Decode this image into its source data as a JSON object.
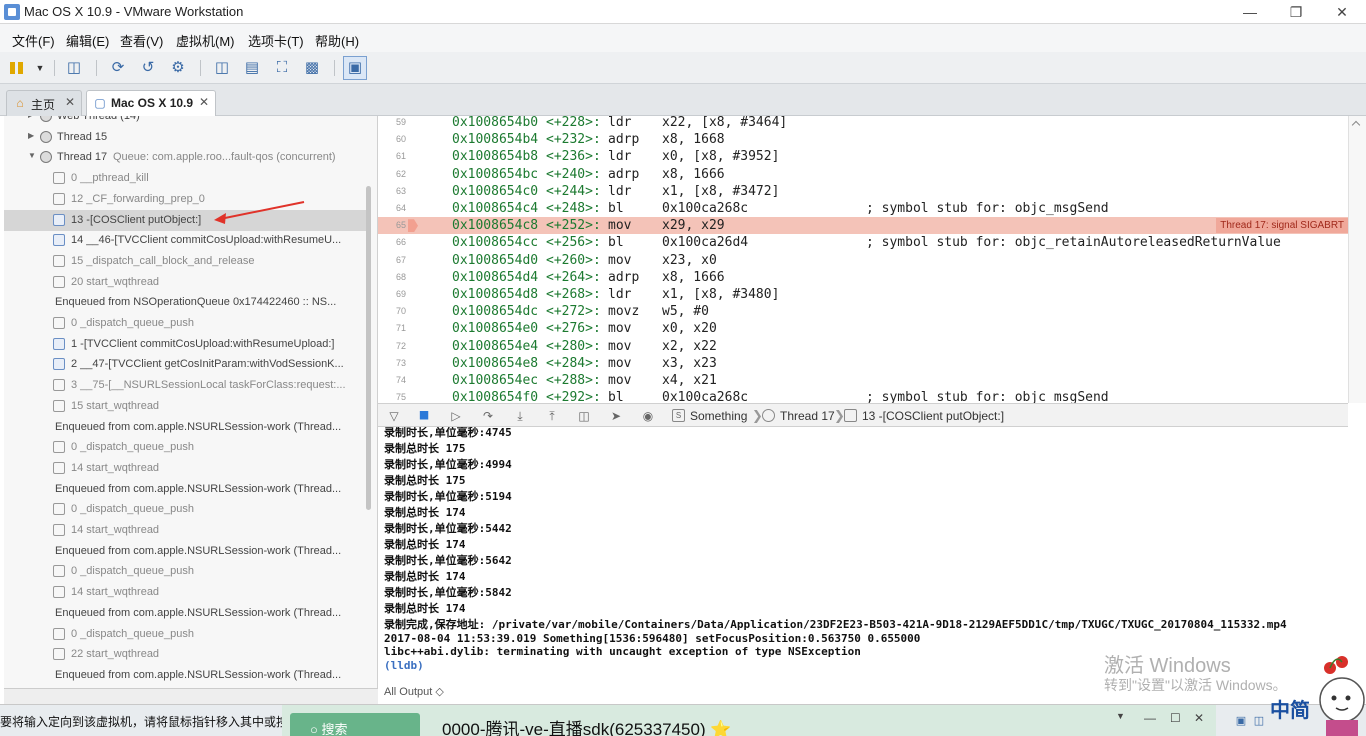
{
  "window": {
    "title": "Mac OS X 10.9 - VMware Workstation",
    "min_icon": "minimize-icon",
    "max_icon": "restore-icon",
    "close_icon": "close-icon"
  },
  "menubar": [
    "文件(F)",
    "编辑(E)",
    "查看(V)",
    "虚拟机(M)",
    "选项卡(T)",
    "帮助(H)"
  ],
  "tabs": [
    {
      "label": "主页",
      "icon": "home-icon",
      "active": false
    },
    {
      "label": "Mac OS X 10.9",
      "icon": "vm-icon",
      "active": true
    }
  ],
  "navigator": {
    "rows": [
      {
        "text": "Web Thread (14)",
        "kind": "thread",
        "indent": 0
      },
      {
        "text": "Thread 15",
        "kind": "thread",
        "indent": 0
      },
      {
        "text": "Thread 17",
        "queue": "Queue: com.apple.roo...fault-qos (concurrent)",
        "kind": "thread",
        "indent": 0,
        "expanded": true
      },
      {
        "text": "0 __pthread_kill",
        "kind": "frame",
        "indent": 1,
        "muted": true
      },
      {
        "text": "12 _CF_forwarding_prep_0",
        "kind": "frame",
        "indent": 1,
        "muted": true
      },
      {
        "text": "13 -[COSClient putObject:]",
        "kind": "user",
        "indent": 1,
        "selected": true
      },
      {
        "text": "14 __46-[TVCClient commitCosUpload:withResumeU...",
        "kind": "user",
        "indent": 1
      },
      {
        "text": "15 _dispatch_call_block_and_release",
        "kind": "frame",
        "indent": 1,
        "muted": true
      },
      {
        "text": "20 start_wqthread",
        "kind": "frame",
        "indent": 1,
        "muted": true
      },
      {
        "text": "Enqueued from NSOperationQueue 0x174422460 :: NS...",
        "kind": "enqueue",
        "indent": 0
      },
      {
        "text": "0 _dispatch_queue_push",
        "kind": "frame",
        "indent": 1,
        "muted": true
      },
      {
        "text": "1 -[TVCClient commitCosUpload:withResumeUpload:]",
        "kind": "user",
        "indent": 1
      },
      {
        "text": "2 __47-[TVCClient getCosInitParam:withVodSessionK...",
        "kind": "user",
        "indent": 1
      },
      {
        "text": "3 __75-[__NSURLSessionLocal taskForClass:request:...",
        "kind": "frame",
        "indent": 1,
        "muted": true
      },
      {
        "text": "15 start_wqthread",
        "kind": "frame",
        "indent": 1,
        "muted": true
      },
      {
        "text": "Enqueued from com.apple.NSURLSession-work (Thread...",
        "kind": "enqueue",
        "indent": 0
      },
      {
        "text": "0 _dispatch_queue_push",
        "kind": "frame",
        "indent": 1,
        "muted": true
      },
      {
        "text": "14 start_wqthread",
        "kind": "frame",
        "indent": 1,
        "muted": true
      },
      {
        "text": "Enqueued from com.apple.NSURLSession-work (Thread...",
        "kind": "enqueue",
        "indent": 0
      },
      {
        "text": "0 _dispatch_queue_push",
        "kind": "frame",
        "indent": 1,
        "muted": true
      },
      {
        "text": "14 start_wqthread",
        "kind": "frame",
        "indent": 1,
        "muted": true
      },
      {
        "text": "Enqueued from com.apple.NSURLSession-work (Thread...",
        "kind": "enqueue",
        "indent": 0
      },
      {
        "text": "0 _dispatch_queue_push",
        "kind": "frame",
        "indent": 1,
        "muted": true
      },
      {
        "text": "14 start_wqthread",
        "kind": "frame",
        "indent": 1,
        "muted": true
      },
      {
        "text": "Enqueued from com.apple.NSURLSession-work (Thread...",
        "kind": "enqueue",
        "indent": 0
      },
      {
        "text": "0 _dispatch_queue_push",
        "kind": "frame",
        "indent": 1,
        "muted": true
      },
      {
        "text": "22 start_wqthread",
        "kind": "frame",
        "indent": 1,
        "muted": true
      },
      {
        "text": "Enqueued from com.apple.NSURLSession-work (Thread...",
        "kind": "enqueue",
        "indent": 0
      }
    ]
  },
  "code": {
    "lines": [
      {
        "ln": "59",
        "addr": "0x1008654b0",
        "off": "<+228>:",
        "op": "ldr",
        "args": "x22, [x8, #3464]",
        "cmt": ""
      },
      {
        "ln": "60",
        "addr": "0x1008654b4",
        "off": "<+232>:",
        "op": "adrp",
        "args": "x8, 1668",
        "cmt": ""
      },
      {
        "ln": "61",
        "addr": "0x1008654b8",
        "off": "<+236>:",
        "op": "ldr",
        "args": "x0, [x8, #3952]",
        "cmt": ""
      },
      {
        "ln": "62",
        "addr": "0x1008654bc",
        "off": "<+240>:",
        "op": "adrp",
        "args": "x8, 1666",
        "cmt": ""
      },
      {
        "ln": "63",
        "addr": "0x1008654c0",
        "off": "<+244>:",
        "op": "ldr",
        "args": "x1, [x8, #3472]",
        "cmt": ""
      },
      {
        "ln": "64",
        "addr": "0x1008654c4",
        "off": "<+248>:",
        "op": "bl",
        "args": "0x100ca268c",
        "cmt": "; symbol stub for: objc_msgSend"
      },
      {
        "ln": "65",
        "addr": "0x1008654c8",
        "off": "<+252>:",
        "op": "mov",
        "args": "x29, x29",
        "cmt": "",
        "highlight": true,
        "badge": "Thread 17: signal SIGABRT"
      },
      {
        "ln": "66",
        "addr": "0x1008654cc",
        "off": "<+256>:",
        "op": "bl",
        "args": "0x100ca26d4",
        "cmt": "; symbol stub for: objc_retainAutoreleasedReturnValue"
      },
      {
        "ln": "67",
        "addr": "0x1008654d0",
        "off": "<+260>:",
        "op": "mov",
        "args": "x23, x0",
        "cmt": ""
      },
      {
        "ln": "68",
        "addr": "0x1008654d4",
        "off": "<+264>:",
        "op": "adrp",
        "args": "x8, 1666",
        "cmt": ""
      },
      {
        "ln": "69",
        "addr": "0x1008654d8",
        "off": "<+268>:",
        "op": "ldr",
        "args": "x1, [x8, #3480]",
        "cmt": ""
      },
      {
        "ln": "70",
        "addr": "0x1008654dc",
        "off": "<+272>:",
        "op": "movz",
        "args": "w5, #0",
        "cmt": ""
      },
      {
        "ln": "71",
        "addr": "0x1008654e0",
        "off": "<+276>:",
        "op": "mov",
        "args": "x0, x20",
        "cmt": ""
      },
      {
        "ln": "72",
        "addr": "0x1008654e4",
        "off": "<+280>:",
        "op": "mov",
        "args": "x2, x22",
        "cmt": ""
      },
      {
        "ln": "73",
        "addr": "0x1008654e8",
        "off": "<+284>:",
        "op": "mov",
        "args": "x3, x23",
        "cmt": ""
      },
      {
        "ln": "74",
        "addr": "0x1008654ec",
        "off": "<+288>:",
        "op": "mov",
        "args": "x4, x21",
        "cmt": ""
      },
      {
        "ln": "75",
        "addr": "0x1008654f0",
        "off": "<+292>:",
        "op": "bl",
        "args": "0x100ca268c",
        "cmt": "; symbol stub for: objc_msgSend"
      }
    ]
  },
  "debugbar": {
    "crumb_app": "Something",
    "crumb_thread": "Thread 17",
    "crumb_frame": "13 -[COSClient putObject:]"
  },
  "console": {
    "lines": [
      "录制时长,单位毫秒:4745",
      "录制总时长 175",
      "录制时长,单位毫秒:4994",
      "录制总时长 175",
      "录制时长,单位毫秒:5194",
      "录制总时长 174",
      "录制时长,单位毫秒:5442",
      "录制总时长 174",
      "录制时长,单位毫秒:5642",
      "录制总时长 174",
      "录制时长,单位毫秒:5842",
      "录制总时长 174",
      "录制完成,保存地址: /private/var/mobile/Containers/Data/Application/23DF2E23-B503-421A-9D18-2129AEF5DD1C/tmp/TXUGC/TXUGC_20170804_115332.mp4",
      "2017-08-04 11:53:39.019 Something[1536:596480] setFocusPosition:0.563750 0.655000",
      "libc++abi.dylib: terminating with uncaught exception of type NSException"
    ],
    "prompt": "(lldb)",
    "output_label": "All Output ◇",
    "watermark_title": "激活 Windows",
    "watermark_sub": "转到\"设置\"以激活 Windows。"
  },
  "taskbar": {
    "hint": "要将输入定向到该虚拟机，请将鼠标指针移入其中或按",
    "qq_search": "○ 搜索",
    "qq_title": "0000-腾讯-ve-直播sdk(625337450) ⭐",
    "ime": "中简"
  }
}
